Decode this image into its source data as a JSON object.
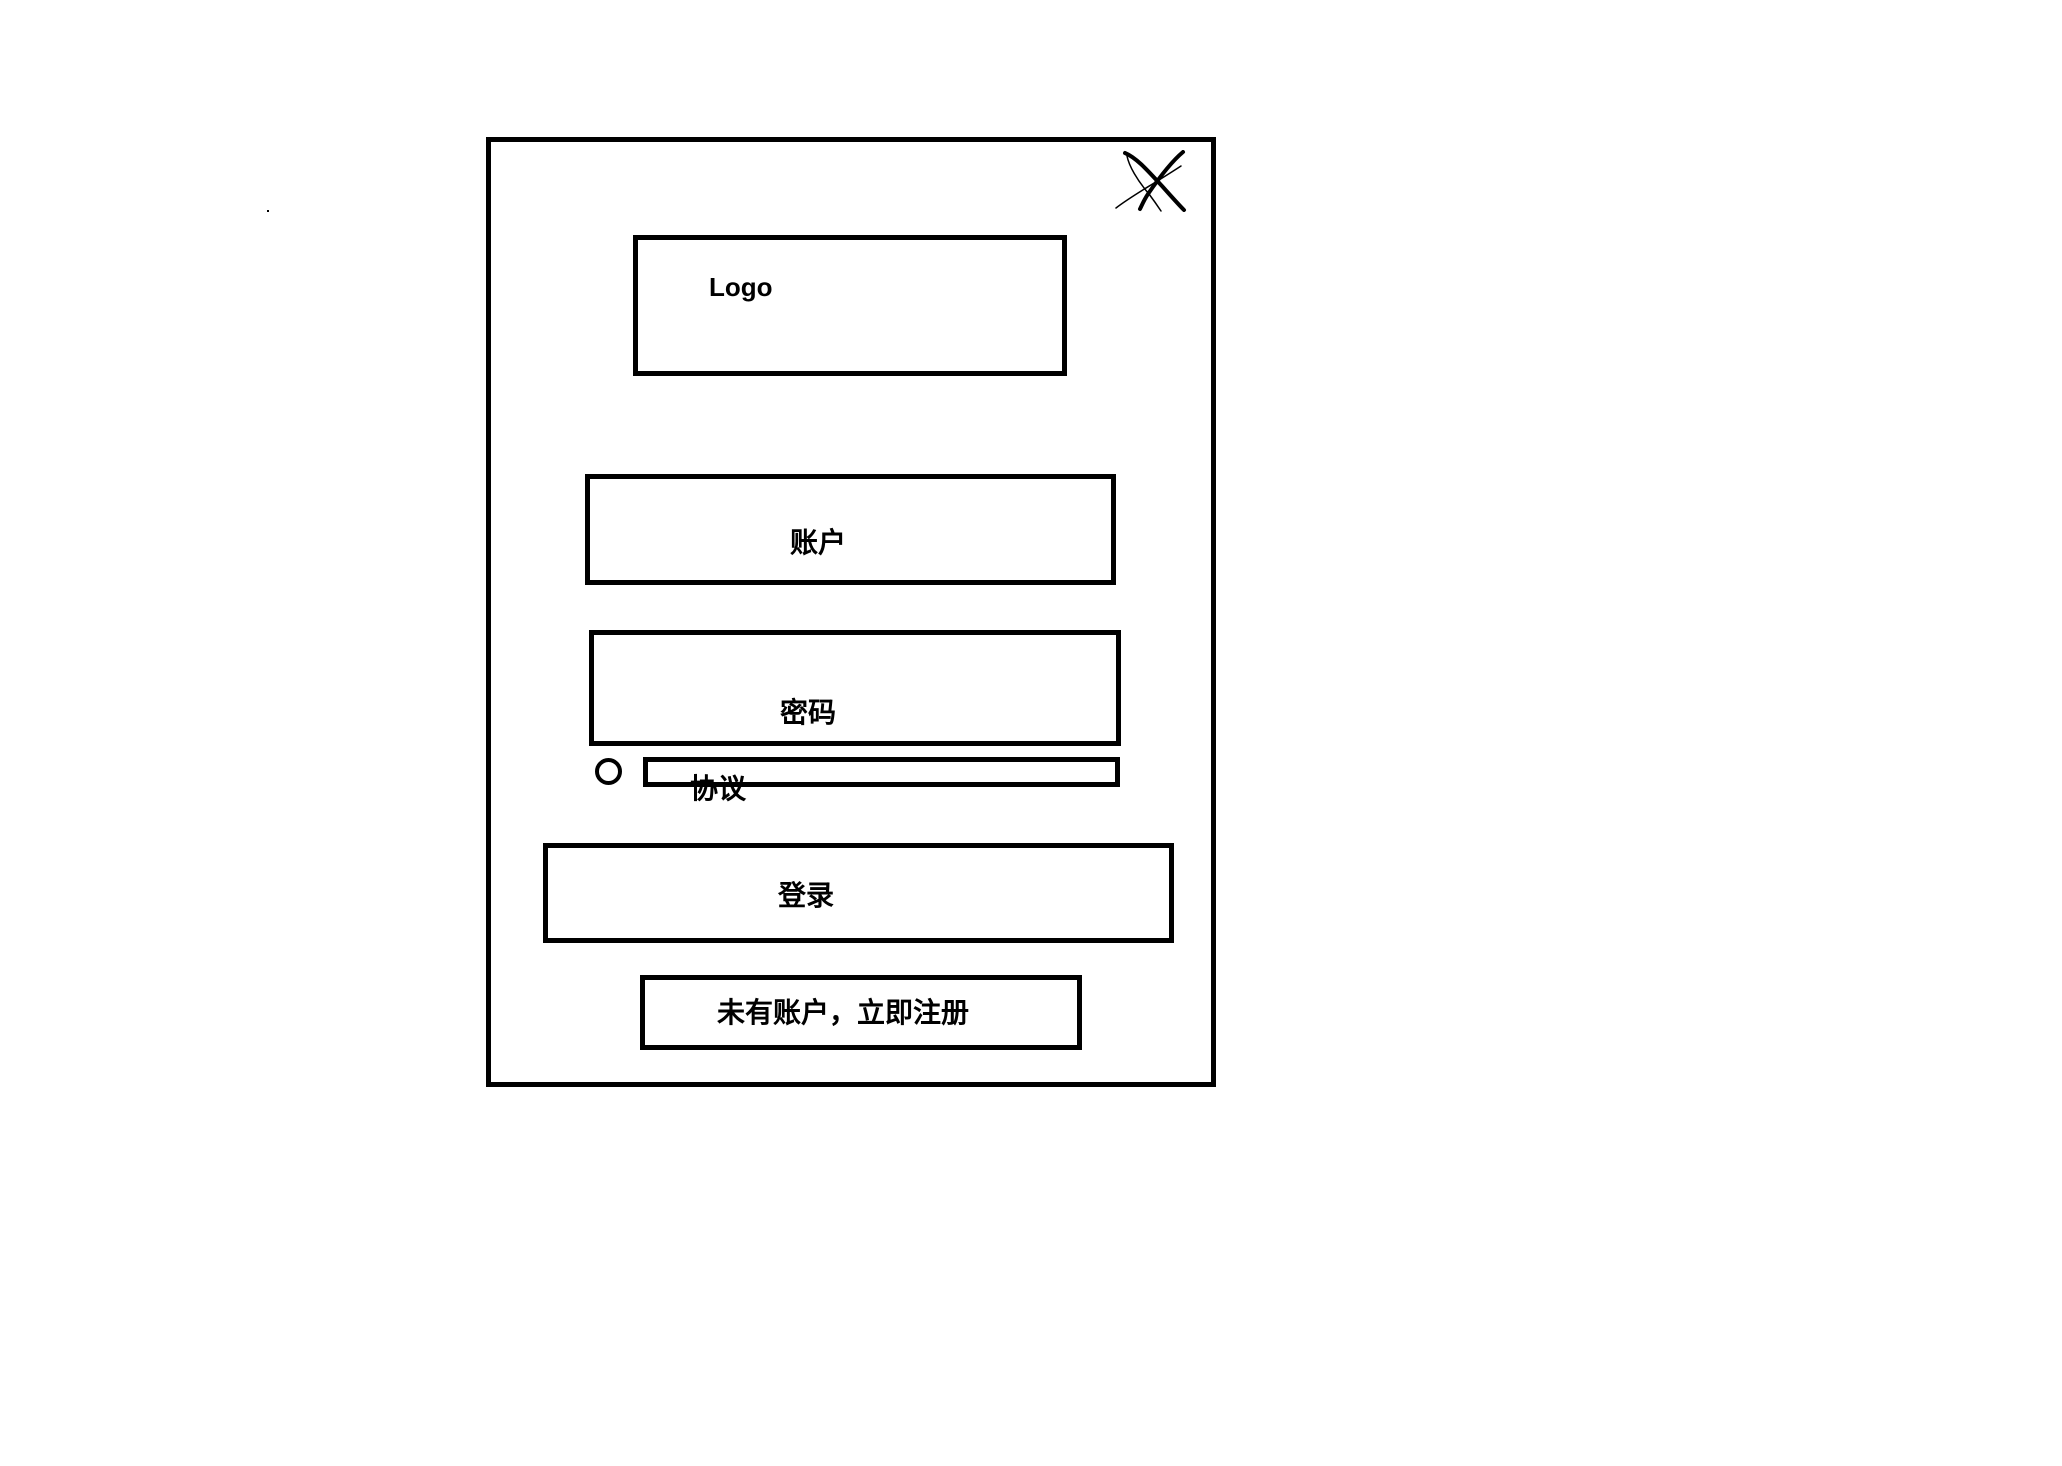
{
  "dialog": {
    "close_icon": "close-icon",
    "logo": {
      "label": "Logo"
    },
    "account": {
      "label": "账户"
    },
    "password": {
      "label": "密码"
    },
    "agreement": {
      "label": "协议"
    },
    "login": {
      "label": "登录"
    },
    "register": {
      "label": "未有账户，立即注册"
    }
  }
}
